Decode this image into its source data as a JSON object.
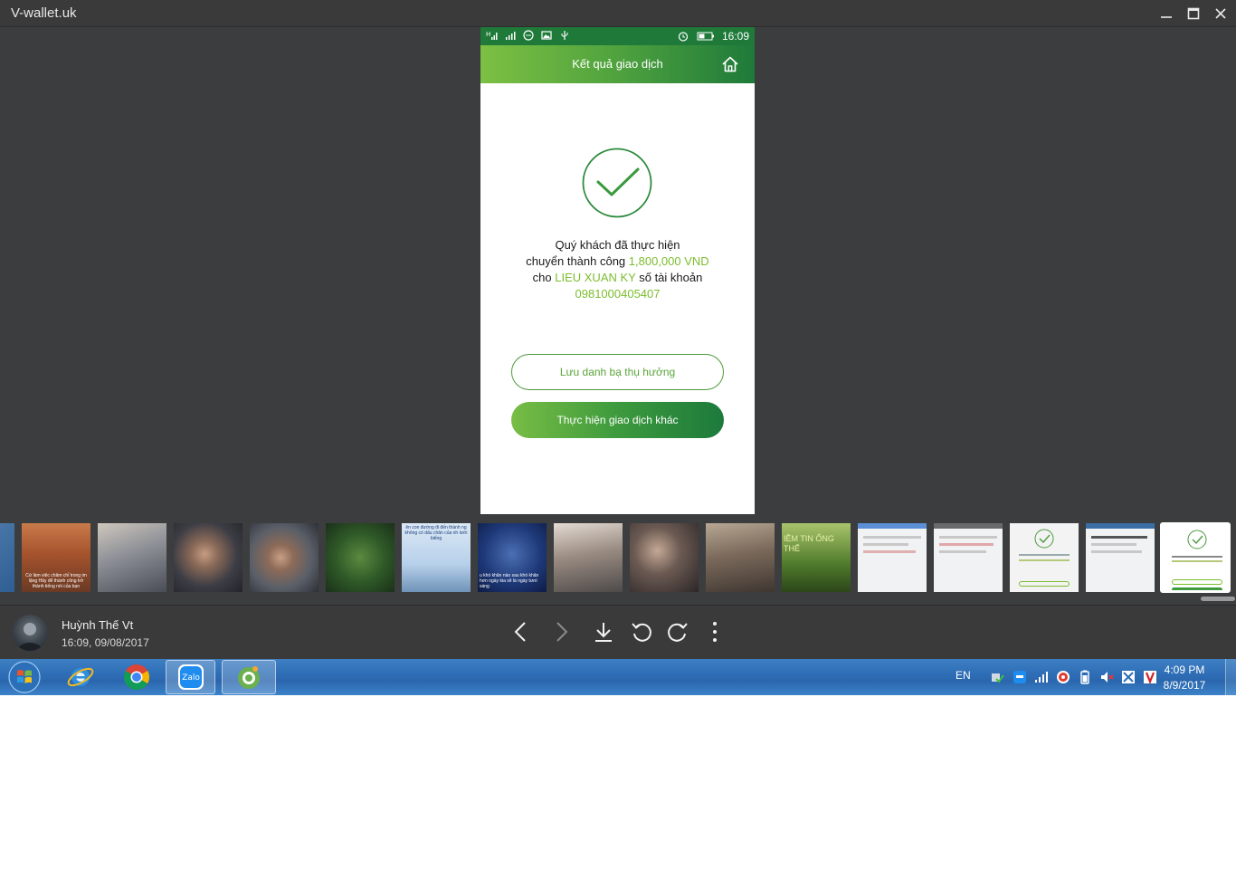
{
  "window": {
    "title": "V-wallet.uk",
    "minimize_icon": "minimize-icon",
    "maximize_icon": "maximize-icon",
    "close_icon": "close-icon"
  },
  "phone": {
    "status_bar": {
      "time": "16:09"
    },
    "header": {
      "title": "Kết quả giao dịch",
      "icon": "home-icon"
    },
    "result": {
      "line1": "Quý khách đã thực hiện",
      "line2_prefix": "chuyển thành công ",
      "amount": "1,800,000 VND",
      "line3_prefix": "cho ",
      "recipient": "LIEU XUAN KY",
      "line3_suffix": " số tài khoản",
      "account_number": "0981000405407"
    },
    "buttons": {
      "save_contact": "Lưu danh bạ thụ hưởng",
      "new_transaction": "Thực hiện giao dịch khác"
    },
    "accent_color": "#7cbd2e"
  },
  "thumbnails": {
    "thumb_2_caption": "Cứ làm việc chăm chỉ trong im lặng Hãy để thành công trở thành tiếng nói của bạn",
    "thumb_7_caption": "ên con đường đi đến thành ng không có dấu chân của nh lười biếng",
    "thumb_8_caption": "u khó khăn nào sau khó khăn hơn ngày kia sẽ là ngày tươi sáng",
    "thumb_12_caption": "IỀM TIN ỐNG THẾ",
    "selected_index": 16
  },
  "bottom_bar": {
    "sender": "Huỳnh Thế Vt",
    "timestamp": "16:09, 09/08/2017",
    "controls": [
      "previous-icon",
      "next-icon",
      "download-icon",
      "rotate-left-icon",
      "rotate-right-icon",
      "more-icon"
    ]
  },
  "taskbar": {
    "language": "EN",
    "time": "4:09 PM",
    "date": "8/9/2017",
    "apps": [
      "internet-explorer-icon",
      "chrome-icon",
      "zalo-icon",
      "coc-coc-icon"
    ],
    "zalo_label": "Zalo"
  }
}
